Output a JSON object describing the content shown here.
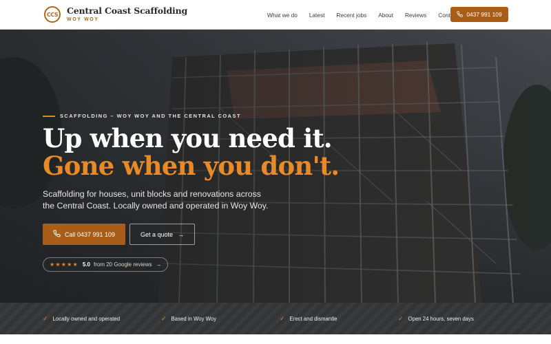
{
  "brand": {
    "logo_text": "CCS",
    "name": "Central Coast Scaffolding",
    "location": "WOY WOY",
    "accent_color": "#a85d18",
    "highlight_color": "#e88a28"
  },
  "nav": {
    "items": [
      {
        "label": "What we do"
      },
      {
        "label": "Latest"
      },
      {
        "label": "Recent jobs"
      },
      {
        "label": "About"
      },
      {
        "label": "Reviews"
      },
      {
        "label": "Contact"
      }
    ],
    "call_label": "0437 991 109",
    "call_icon": "phone-icon"
  },
  "hero": {
    "eyebrow": "SCAFFOLDING – WOY WOY AND THE CENTRAL COAST",
    "headline_line1": "Up when you need it.",
    "headline_line2": "Gone when you don't.",
    "subtext": "Scaffolding for houses, unit blocks and renovations across the Central Coast. Locally owned and operated in Woy Woy.",
    "call_button": "Call 0437 991 109",
    "quote_button": "Get a quote",
    "quote_arrow": "→",
    "background": "scaffolding-photo"
  },
  "reviews": {
    "stars": "★★★★★",
    "rating": "5.0",
    "text": "from 20 Google reviews",
    "arrow": "→"
  },
  "features": [
    {
      "label": "Locally owned and operated",
      "icon": "check-icon"
    },
    {
      "label": "Based in Woy Woy",
      "icon": "check-icon"
    },
    {
      "label": "Erect and dismantle",
      "icon": "check-icon"
    },
    {
      "label": "Open 24 hours, seven days",
      "icon": "check-icon"
    }
  ]
}
